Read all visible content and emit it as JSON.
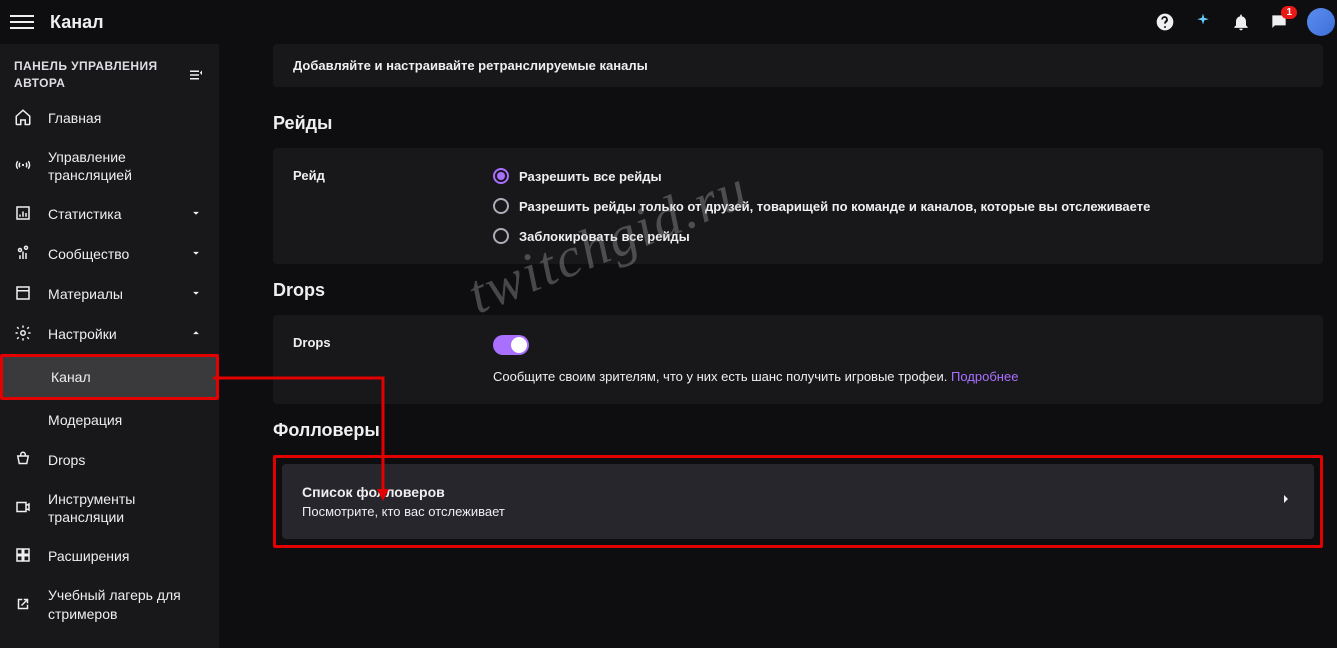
{
  "topbar": {
    "title": "Канал",
    "notif_count": "1"
  },
  "sidebar": {
    "heading": "ПАНЕЛЬ УПРАВЛЕНИЯ АВТОРА",
    "home": "Главная",
    "stream": "Управление трансляцией",
    "stats": "Статистика",
    "community": "Сообщество",
    "materials": "Материалы",
    "settings": "Настройки",
    "channel": "Канал",
    "moderation": "Модерация",
    "drops": "Drops",
    "tools": "Инструменты трансляции",
    "extensions": "Расширения",
    "bootcamp": "Учебный лагерь для стримеров"
  },
  "retranslate": {
    "desc": "Добавляйте и настраивайте ретранслируемые каналы"
  },
  "raids": {
    "title": "Рейды",
    "label": "Рейд",
    "opt1": "Разрешить все рейды",
    "opt2": "Разрешить рейды только от друзей, товарищей по команде и каналов, которые вы отслеживаете",
    "opt3": "Заблокировать все рейды"
  },
  "drops": {
    "title": "Drops",
    "label": "Drops",
    "desc": "Сообщите своим зрителям, что у них есть шанс получить игровые трофеи.",
    "more": "Подробнее"
  },
  "followers": {
    "title": "Фолловеры",
    "card_title": "Список фолловеров",
    "card_desc": "Посмотрите, кто вас отслеживает"
  },
  "watermark": "twitchgid.ru"
}
